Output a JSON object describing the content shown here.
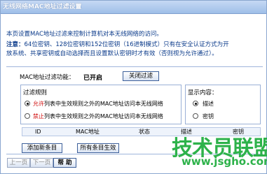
{
  "window": {
    "title": "无线网络MAC地址过滤设置"
  },
  "content": {
    "intro": "本页设置MAC地址过滤来控制计算机对本无线网络的访问。",
    "note_label": "注意：",
    "note_line1": "64位密钥、128位密钥和152位密钥（16进制模式）只有在安全认证方式为开",
    "note_line2": "放系统、共享密钥或自动选择而且设置默认密钥时才有效（否则视为允许通过）。",
    "mac_filter_label": "MAC地址过滤功能：",
    "mac_filter_status": "已开启",
    "close_filter_button": "关闭过滤"
  },
  "rules": {
    "legend": "过滤规则",
    "allow_prefix": "允许",
    "allow_text": "列表中生效规则之外的MAC地址访问本无线网络",
    "deny_prefix": "禁止",
    "deny_text": "列表中生效规则之外的MAC地址访问本无线网络",
    "selected": "allow"
  },
  "display": {
    "legend": "显示内容：",
    "options": [
      "描述",
      "密钥"
    ],
    "selected": "描述"
  },
  "table": {
    "columns": [
      "ID",
      "MAC地址",
      "状态",
      "描述",
      "密钥"
    ]
  },
  "buttons": {
    "add": "添加新条目",
    "enable_all": "所有条目生效",
    "prev": "上一页",
    "next": "下一页",
    "help": "帮 助"
  },
  "watermark": {
    "text": "技术员联盟",
    "url": "www.jsgho.com",
    "color": "#2db24a"
  }
}
